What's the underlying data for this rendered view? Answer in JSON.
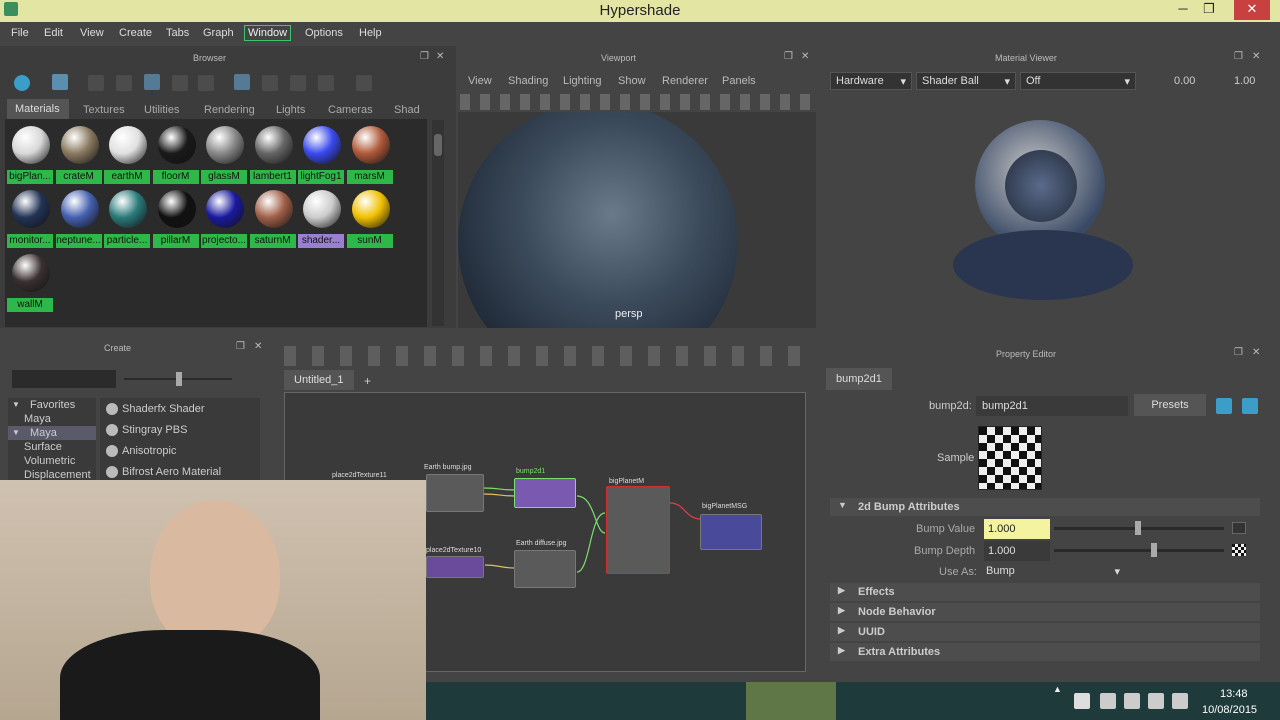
{
  "window": {
    "title": "Hypershade"
  },
  "menu": [
    "File",
    "Edit",
    "View",
    "Create",
    "Tabs",
    "Graph",
    "Window",
    "Options",
    "Help"
  ],
  "browser": {
    "title": "Browser",
    "tabs": [
      "Materials",
      "Textures",
      "Utilities",
      "Rendering",
      "Lights",
      "Cameras",
      "Shad"
    ],
    "materials": [
      {
        "label": "bigPlan...",
        "color": "#d8d8d8"
      },
      {
        "label": "crateM",
        "color": "#8a7a60"
      },
      {
        "label": "earthM",
        "color": "#e0e0e0"
      },
      {
        "label": "floorM",
        "color": "#1a1a1a"
      },
      {
        "label": "glassM",
        "color": "#888888"
      },
      {
        "label": "lambert1",
        "color": "#666666"
      },
      {
        "label": "lightFog1",
        "color": "#3a4aee"
      },
      {
        "label": "marsM",
        "color": "#b05a3a"
      },
      {
        "label": "monitor...",
        "color": "#223355"
      },
      {
        "label": "neptune...",
        "color": "#4460b0"
      },
      {
        "label": "particle...",
        "color": "#2a7a7a"
      },
      {
        "label": "pillarM",
        "color": "#111111"
      },
      {
        "label": "projecto...",
        "color": "#1a1aa0"
      },
      {
        "label": "saturnM",
        "color": "#a06048"
      },
      {
        "label": "shader...",
        "color": "#cccccc"
      },
      {
        "label": "sunM",
        "color": "#f0c000"
      },
      {
        "label": "wallM",
        "color": "#3a3030"
      }
    ]
  },
  "viewport": {
    "title": "Viewport",
    "menu": [
      "View",
      "Shading",
      "Lighting",
      "Show",
      "Renderer",
      "Panels"
    ],
    "camera": "persp"
  },
  "material_viewer": {
    "title": "Material Viewer",
    "renderer": "Hardware",
    "geometry": "Shader Ball",
    "env": "Off",
    "val1": "0.00",
    "val2": "1.00"
  },
  "create": {
    "title": "Create",
    "tree": [
      "Favorites",
      "Maya",
      "Maya",
      "Surface",
      "Volumetric",
      "Displacement"
    ],
    "items": [
      "Shaderfx Shader",
      "Stingray PBS",
      "Anisotropic",
      "Bifrost Aero Material"
    ]
  },
  "graph": {
    "tab": "Untitled_1",
    "nodes": {
      "place2d1": "place2dTexture11",
      "earth_bump": "Earth bump.jpg",
      "bump2d1": "bump2d1",
      "bigPlanetM": "bigPlanetM",
      "bigPlanetMSG": "bigPlanetMSG",
      "place2d10": "place2dTexture10",
      "earth_diffuse": "Earth diffuse.jpg"
    }
  },
  "property_editor": {
    "title": "Property Editor",
    "tab": "bump2d1",
    "node_label": "bump2d:",
    "node_name": "bump2d1",
    "presets": "Presets",
    "sample_label": "Sample",
    "section": "2d Bump Attributes",
    "bump_value_label": "Bump Value",
    "bump_value": "1.000",
    "bump_depth_label": "Bump Depth",
    "bump_depth": "1.000",
    "use_as_label": "Use As:",
    "use_as": "Bump",
    "collapsed": [
      "Effects",
      "Node Behavior",
      "UUID",
      "Extra Attributes"
    ]
  },
  "taskbar": {
    "time": "13:48",
    "date": "10/08/2015"
  }
}
